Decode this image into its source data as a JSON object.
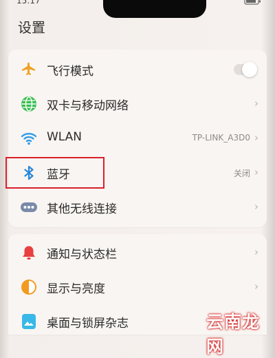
{
  "status": {
    "time": "15:17"
  },
  "header": {
    "title": "设置"
  },
  "settings": {
    "items": [
      {
        "label": "飞行模式",
        "icon": "airplane-icon",
        "control": "toggle",
        "on": false
      },
      {
        "label": "双卡与移动网络",
        "icon": "globe-icon"
      },
      {
        "label": "WLAN",
        "icon": "wifi-icon",
        "value": "TP-LINK_A3D0"
      },
      {
        "label": "蓝牙",
        "icon": "bluetooth-icon",
        "value": "关闭"
      },
      {
        "label": "其他无线连接",
        "icon": "more-dots-icon"
      },
      {
        "label": "通知与状态栏",
        "icon": "bell-icon"
      },
      {
        "label": "显示与亮度",
        "icon": "brightness-icon"
      },
      {
        "label": "桌面与锁屏杂志",
        "icon": "wallpaper-icon"
      }
    ]
  },
  "chevron": "›",
  "watermark": {
    "text": "云南龙网"
  },
  "colors": {
    "airplane": "#f0a020",
    "globe": "#3cbf52",
    "wifi": "#2f9be8",
    "bluetooth": "#2a86d8",
    "dots": "#7a8aa8",
    "bell": "#e84040",
    "brightness": "#f29a1e",
    "wallpaper": "#38b8e8",
    "highlight": "#d8202a"
  }
}
